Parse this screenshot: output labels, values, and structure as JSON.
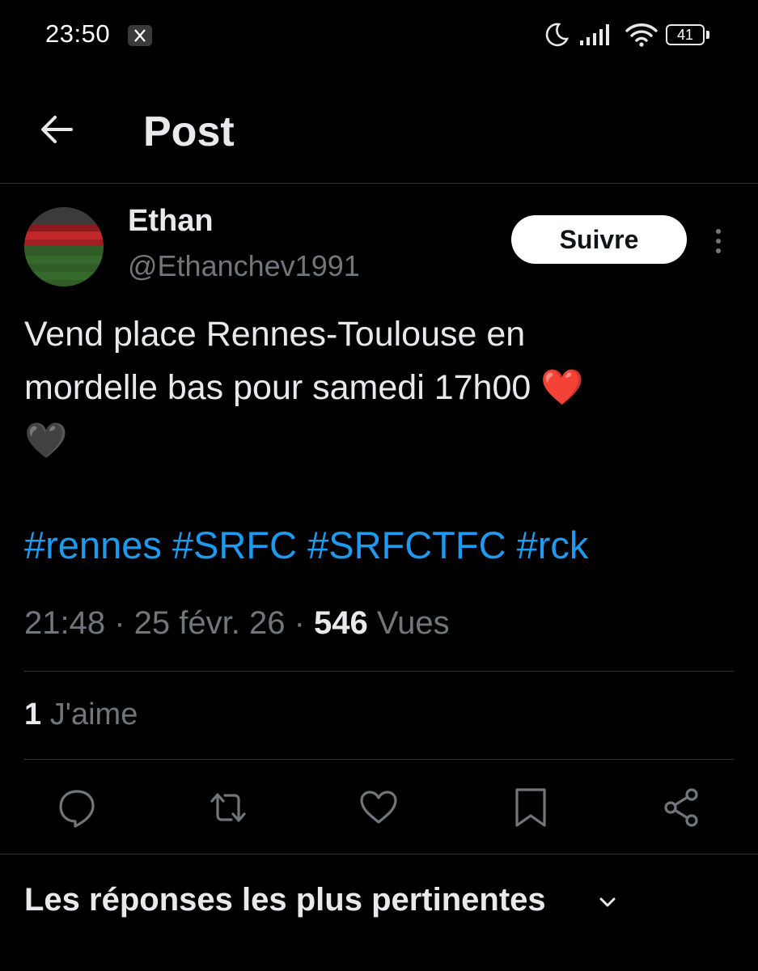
{
  "status_bar": {
    "time": "23:50",
    "battery": "41",
    "icons": [
      "x-app-icon",
      "moon-icon",
      "signal-icon",
      "wifi-icon",
      "battery-icon"
    ]
  },
  "header": {
    "title": "Post",
    "back_icon": "arrow-left-icon"
  },
  "author": {
    "name": "Ethan",
    "handle": "@Ethanchev1991",
    "follow_label": "Suivre",
    "more_icon": "vertical-dots-icon"
  },
  "tweet": {
    "text_line1": "Vend place Rennes-Toulouse en",
    "text_line2": "mordelle bas pour samedi 17h00 ❤️",
    "text_line3": "🖤",
    "hashtags": [
      "#rennes",
      "#SRFC",
      "#SRFCTFC",
      "#rck"
    ],
    "hashtag_color": "#1d9bf0"
  },
  "meta": {
    "time": "21:48",
    "separator": " · ",
    "date": "25 févr. 26",
    "views_count": "546",
    "views_label": "Vues"
  },
  "likes": {
    "count": "1",
    "label": "J'aime"
  },
  "actions": {
    "icons": [
      "reply-icon",
      "retweet-icon",
      "like-icon",
      "bookmark-icon",
      "share-icon"
    ]
  },
  "replies": {
    "sort_label": "Les réponses les plus pertinentes"
  }
}
